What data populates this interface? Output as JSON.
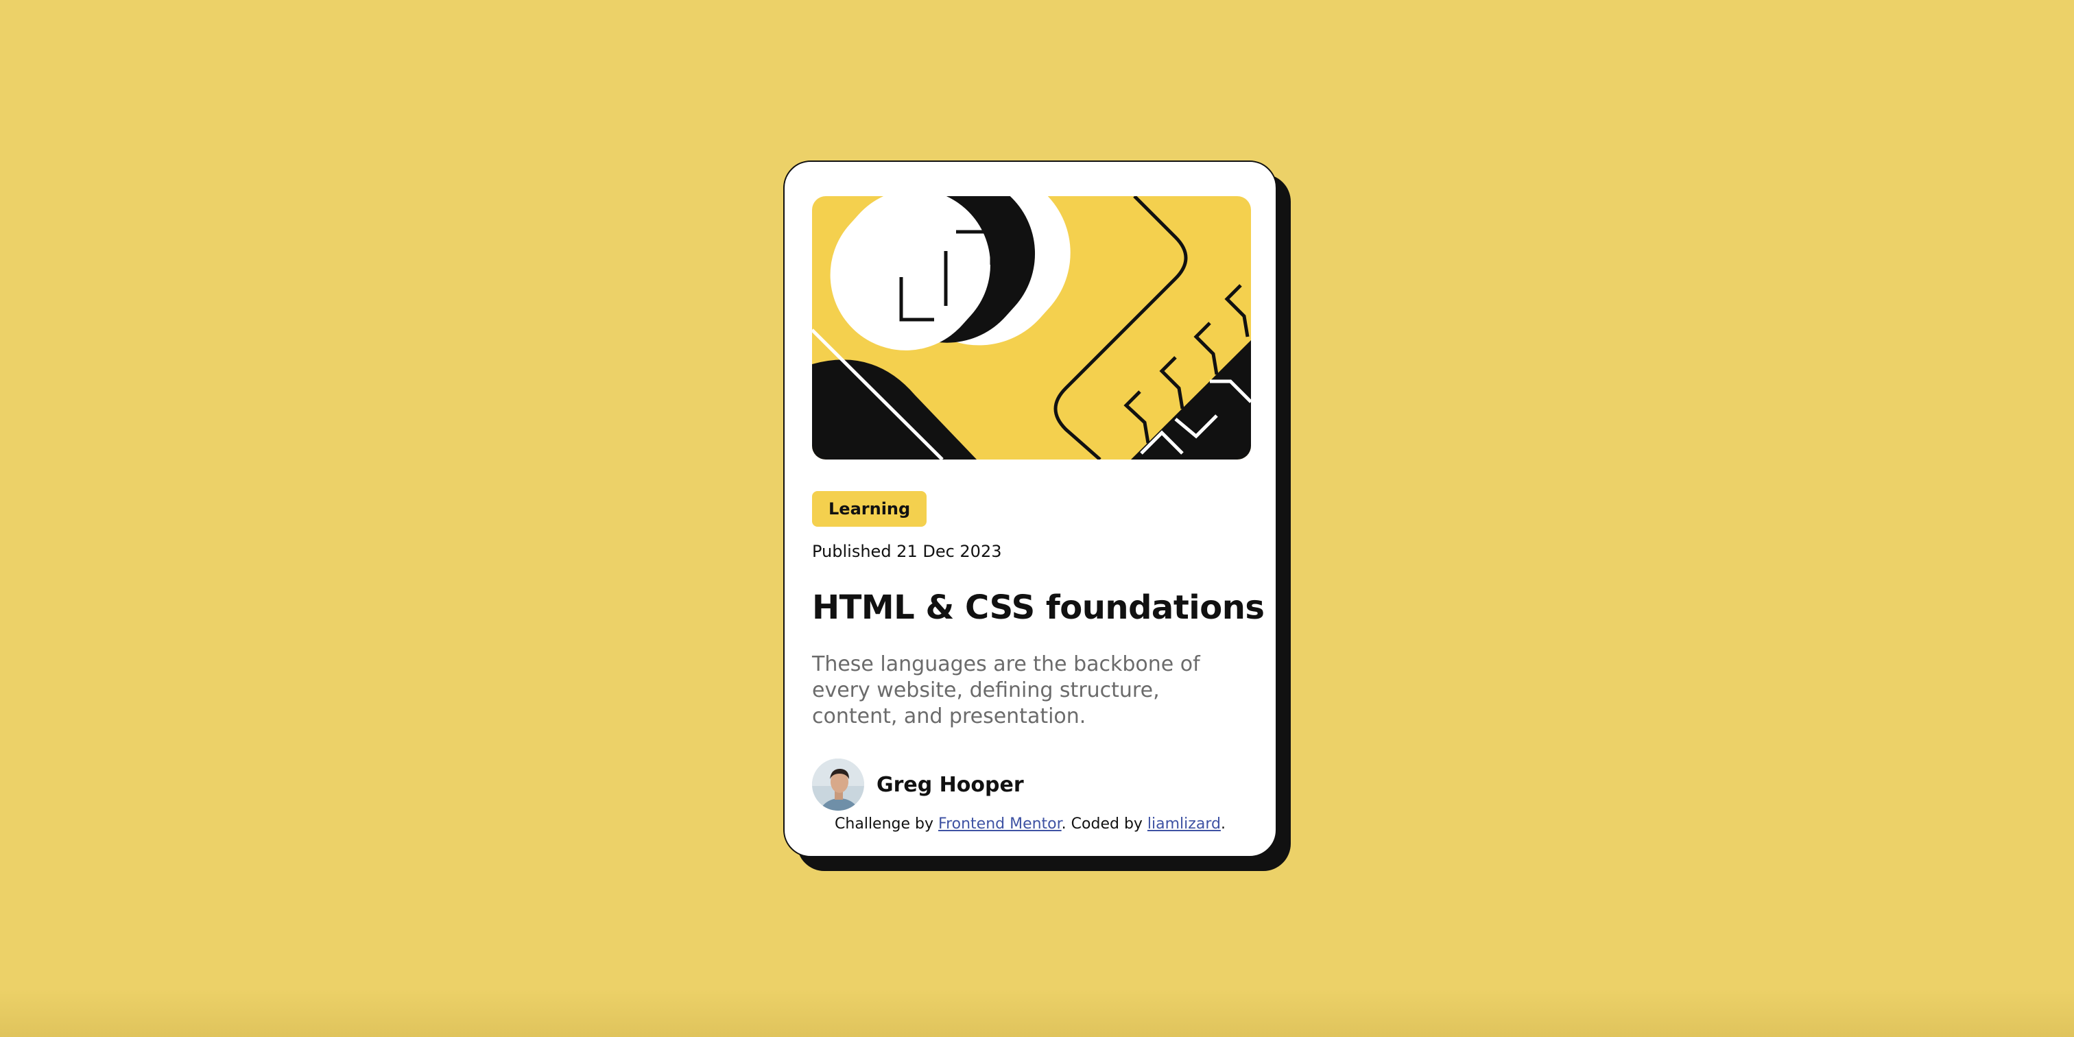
{
  "theme": {
    "background": "#ECD168",
    "card_background": "#FFFFFF",
    "ink": "#111111",
    "tag_background": "#F4D04E",
    "muted_text": "#6B6B6B",
    "link_color": "#3E52A3"
  },
  "card": {
    "hero_image": "illustration-article",
    "tag": "Learning",
    "published": "Published 21 Dec 2023",
    "title": "HTML & CSS foundations",
    "description": "These languages are the backbone of every website, defining structure, content, and presentation.",
    "author": {
      "avatar": "image-avatar",
      "name": "Greg Hooper"
    }
  },
  "attribution": {
    "prefix": "Challenge by ",
    "link1_text": "Frontend Mentor",
    "middle": ". Coded by ",
    "link2_text": "liamlizard",
    "suffix": "."
  }
}
